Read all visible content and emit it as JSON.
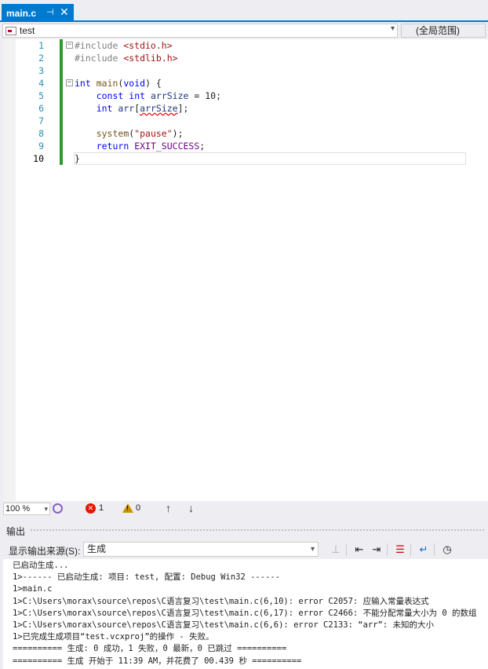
{
  "tab": {
    "title": "main.c",
    "pin_glyph": "⊣",
    "close_glyph": "✕"
  },
  "navbar": {
    "project": "test",
    "scope": "(全局范围)"
  },
  "editor": {
    "line_numbers": [
      "1",
      "2",
      "3",
      "4",
      "5",
      "6",
      "7",
      "8",
      "9",
      "10"
    ],
    "active_line": 10
  },
  "status": {
    "zoom": "100 %",
    "errors": "1",
    "warnings": "0"
  },
  "output": {
    "title": "输出",
    "source_label": "显示输出来源(S):",
    "source_value": "生成",
    "lines": [
      "已启动生成...",
      "1>------ 已启动生成: 项目: test, 配置: Debug Win32 ------",
      "1>main.c",
      "1>C:\\Users\\morax\\source\\repos\\C语言复习\\test\\main.c(6,10): error C2057: 应输入常量表达式",
      "1>C:\\Users\\morax\\source\\repos\\C语言复习\\test\\main.c(6,17): error C2466: 不能分配常量大小为 0 的数组",
      "1>C:\\Users\\morax\\source\\repos\\C语言复习\\test\\main.c(6,6): error C2133: “arr”: 未知的大小",
      "1>已完成生成项目“test.vcxproj”的操作 - 失败。",
      "========== 生成: 0 成功，1 失败，0 最新，0 已跳过 ==========",
      "========== 生成 开始于 11:39 AM，并花费了 00.439 秒 =========="
    ]
  },
  "code": {
    "l1": {
      "pp": "#include ",
      "str": "<stdio.h>"
    },
    "l2": {
      "pp": "#include ",
      "str": "<stdlib.h>"
    },
    "l4": {
      "kw1": "int",
      "fn": "main",
      "p1": "(",
      "kw2": "void",
      "p2": ") {"
    },
    "l5": {
      "kw1": "const",
      "kw2": "int",
      "var": "arrSize",
      "rest": " = 10;"
    },
    "l6": {
      "kw": "int",
      "var": "arr",
      "p1": "[",
      "idx": "arrSize",
      "p2": "];"
    },
    "l8": {
      "fn": "system",
      "p1": "(",
      "str": "\"pause\"",
      "p2": ");"
    },
    "l9": {
      "kw": "return",
      "mac": "EXIT_SUCCESS",
      "p": ";"
    },
    "l10": {
      "brace": "}"
    }
  }
}
